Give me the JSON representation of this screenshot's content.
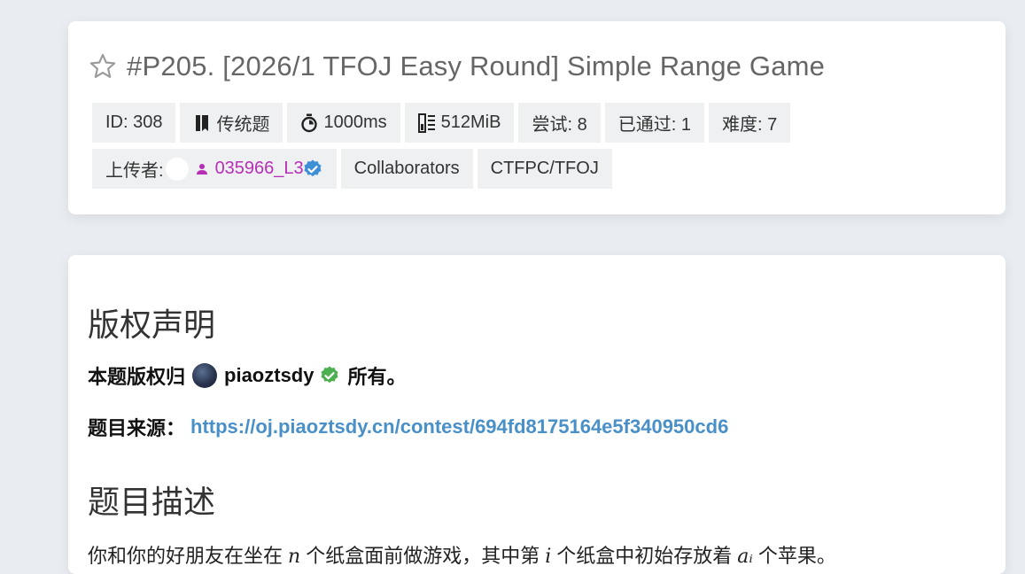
{
  "problem": {
    "title": "#P205. [2026/1 TFOJ Easy Round] Simple Range Game",
    "tags_row1": {
      "id": "ID: 308",
      "type": "传统题",
      "time": "1000ms",
      "memory": "512MiB",
      "tried": "尝试: 8",
      "accepted": "已通过: 1",
      "difficulty": "难度: 7"
    },
    "tags_row2": {
      "uploader_label": "上传者:",
      "uploader_name": "035966_L3",
      "collaborators": "Collaborators",
      "source_tag": "CTFPC/TFOJ"
    }
  },
  "content": {
    "copyright_heading": "版权声明",
    "copyright_prefix": "本题版权归",
    "copyright_owner": "piaoztsdy",
    "copyright_suffix": "所有。",
    "source_label": "题目来源：",
    "source_url": "https://oj.piaoztsdy.cn/contest/694fd8175164e5f340950cd6",
    "desc_heading": "题目描述",
    "desc_part1": "你和你的好朋友在坐在",
    "desc_var_n": "n",
    "desc_part2": "个纸盒面前做游戏，其中第",
    "desc_var_i": "i",
    "desc_part3": "个纸盒中初始存放着",
    "desc_var_a": "aᵢ",
    "desc_part4": "个苹果。"
  },
  "colors": {
    "background": "#e9edf1",
    "tag_bg": "#eef0f2",
    "user_link": "#b62fb6",
    "verified_blue": "#3d8fd6",
    "verified_green": "#4caf50",
    "link": "#4a90c8"
  },
  "icons": {
    "star": "star-outline-icon",
    "type": "book-icon",
    "time": "stopwatch-icon",
    "memory": "memory-icon",
    "user": "person-icon",
    "verified": "verified-badge-icon"
  }
}
